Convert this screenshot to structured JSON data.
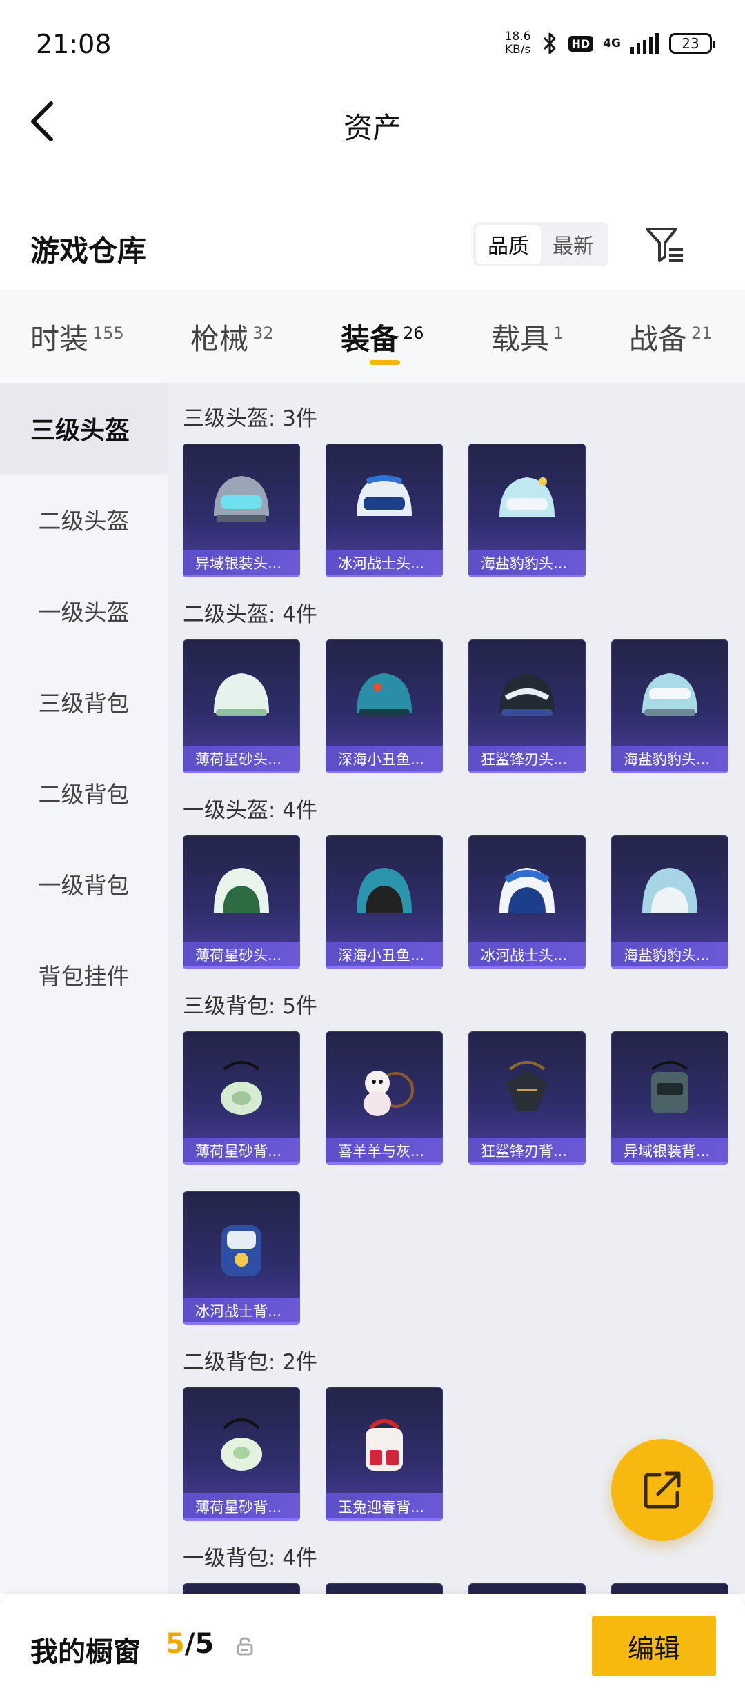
{
  "status_bar": {
    "time": "21:08",
    "net_speed_value": "18.6",
    "net_speed_unit": "KB/s",
    "hd": "HD",
    "network": "4G",
    "battery": "23"
  },
  "header": {
    "title": "资产"
  },
  "warehouse": {
    "title": "游戏仓库",
    "sort_quality": "品质",
    "sort_newest": "最新"
  },
  "tabs": [
    {
      "label": "时装",
      "count": "155"
    },
    {
      "label": "枪械",
      "count": "32"
    },
    {
      "label": "装备",
      "count": "26"
    },
    {
      "label": "载具",
      "count": "1"
    },
    {
      "label": "战备",
      "count": "21"
    }
  ],
  "sidebar": {
    "items": [
      {
        "label": "三级头盔"
      },
      {
        "label": "二级头盔"
      },
      {
        "label": "一级头盔"
      },
      {
        "label": "三级背包"
      },
      {
        "label": "二级背包"
      },
      {
        "label": "一级背包"
      },
      {
        "label": "背包挂件"
      }
    ]
  },
  "sections": [
    {
      "title": "三级头盔: 3件",
      "items": [
        "异域银装头...",
        "冰河战士头...",
        "海盐豹豹头..."
      ]
    },
    {
      "title": "二级头盔: 4件",
      "items": [
        "薄荷星砂头...",
        "深海小丑鱼...",
        "狂鲨锋刃头...",
        "海盐豹豹头..."
      ]
    },
    {
      "title": "一级头盔: 4件",
      "items": [
        "薄荷星砂头...",
        "深海小丑鱼...",
        "冰河战士头...",
        "海盐豹豹头..."
      ]
    },
    {
      "title": "三级背包: 5件",
      "items": [
        "薄荷星砂背...",
        "喜羊羊与灰...",
        "狂鲨锋刃背...",
        "异域银装背...",
        "冰河战士背..."
      ]
    },
    {
      "title": "二级背包: 2件",
      "items": [
        "薄荷星砂背...",
        "玉兔迎春背..."
      ]
    },
    {
      "title": "一级背包: 4件",
      "items": []
    }
  ],
  "bottom_bar": {
    "showcase_label": "我的橱窗",
    "showcase_current": "5",
    "showcase_separator": "/",
    "showcase_total": "5",
    "edit_label": "编辑"
  },
  "colors": {
    "accent": "#f7b80f",
    "card_top": "#232448",
    "card_bottom": "#4a3f9e"
  },
  "icons": [
    "back-arrow-icon",
    "filter-icon",
    "bluetooth-icon",
    "signal-icon",
    "lock-icon",
    "share-out-icon"
  ]
}
